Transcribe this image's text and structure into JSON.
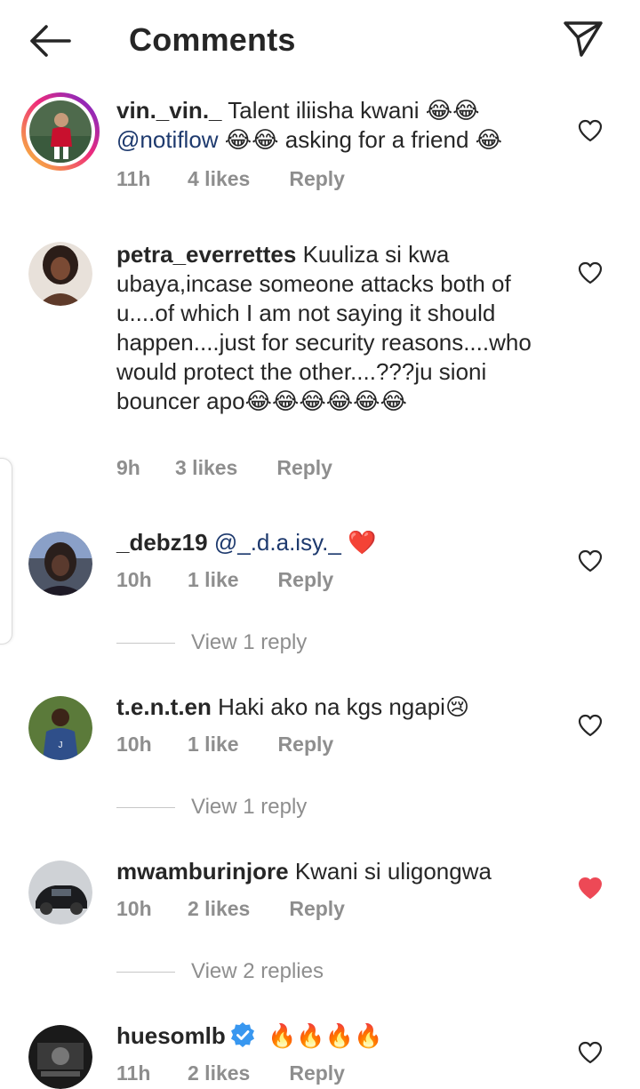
{
  "header": {
    "title": "Comments",
    "back_icon": "arrow-left-icon",
    "share_icon": "paper-plane-icon"
  },
  "colors": {
    "text": "#262626",
    "secondary": "#8e8e8e",
    "mention": "#1e3a6e",
    "liked_heart": "#ed4956",
    "verified": "#3897f0"
  },
  "comments": [
    {
      "username": "vin._vin._",
      "text_parts": [
        " Talent iliisha kwani 😂😂\n",
        "@notiflow",
        " 😂😂 asking for a friend 😂"
      ],
      "time": "11h",
      "likes": "4 likes",
      "reply": "Reply",
      "liked": false
    },
    {
      "username": "petra_everrettes",
      "text": " Kuuliza si kwa ubaya,incase someone attacks both of u....of which I am not saying it should happen....just for security reasons....who would protect the other....???ju sioni bouncer apo😂😂😂😂😂😂",
      "time": "9h",
      "likes": "3 likes",
      "reply": "Reply",
      "liked": false
    },
    {
      "username": "_debz19",
      "mention": "@_.d.a.isy._",
      "text": " ❤️",
      "time": "10h",
      "likes": "1 like",
      "reply": "Reply",
      "liked": false,
      "view_replies": "View 1 reply"
    },
    {
      "username": "t.e.n.t.en",
      "text": " Haki ako na kgs ngapi😢",
      "time": "10h",
      "likes": "1 like",
      "reply": "Reply",
      "liked": false,
      "view_replies": "View 1 reply"
    },
    {
      "username": "mwamburinjore",
      "text": " Kwani si uligongwa",
      "time": "10h",
      "likes": "2 likes",
      "reply": "Reply",
      "liked": true,
      "view_replies": "View 2 replies"
    },
    {
      "username": "huesomlb",
      "verified": true,
      "text": " 🔥🔥🔥🔥",
      "time": "11h",
      "likes": "2 likes",
      "reply": "Reply",
      "liked": false
    }
  ]
}
